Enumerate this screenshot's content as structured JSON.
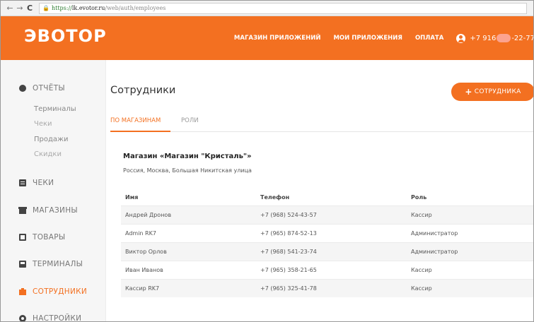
{
  "browser": {
    "back": "←",
    "forward": "→",
    "reload": "C",
    "url_proto": "https://",
    "url_host": "lk.evotor.ru",
    "url_path": "/web/auth/employees"
  },
  "header": {
    "logo": "ЭВОТОР",
    "nav": [
      "МАГАЗИН ПРИЛОЖЕНИЙ",
      "МОИ ПРИЛОЖЕНИЯ",
      "ОПЛАТА"
    ],
    "phone_prefix": "+7 916",
    "phone_suffix": "-22-77",
    "accent_color": "#f37021"
  },
  "sidebar": {
    "reports": {
      "label": "ОТЧЁТЫ",
      "icon": "reports-icon"
    },
    "reports_sub": [
      "Терминалы",
      "Чеки",
      "Продажи",
      "Скидки"
    ],
    "items": [
      {
        "label": "ЧЕКИ",
        "icon": "receipt-icon"
      },
      {
        "label": "МАГАЗИНЫ",
        "icon": "store-icon"
      },
      {
        "label": "ТОВАРЫ",
        "icon": "box-icon"
      },
      {
        "label": "ТЕРМИНАЛЫ",
        "icon": "terminal-icon"
      },
      {
        "label": "СОТРУДНИКИ",
        "icon": "employees-icon",
        "active": true
      },
      {
        "label": "НАСТРОЙКИ",
        "icon": "gear-icon"
      }
    ]
  },
  "main": {
    "title": "Сотрудники",
    "add_button": "СОТРУДНИКА",
    "tabs": [
      "ПО МАГАЗИНАМ",
      "РОЛИ"
    ],
    "store": {
      "name": "Магазин «Магазин \"Кристаль\"»",
      "address": "Россия, Москва, Большая Никитская улица"
    },
    "table": {
      "headers": [
        "Имя",
        "Телефон",
        "Роль"
      ],
      "rows": [
        [
          "Андрей Дронов",
          "+7 (968) 524-43-57",
          "Кассир"
        ],
        [
          "Admin RK7",
          "+7 (965) 874-52-13",
          "Администратор"
        ],
        [
          "Виктор Орлов",
          "+7 (968) 541-23-74",
          "Администратор"
        ],
        [
          "Иван Иванов",
          "+7 (965) 358-21-65",
          "Кассир"
        ],
        [
          "Кассир RK7",
          "+7 (965) 325-41-78",
          "Кассир"
        ]
      ]
    }
  }
}
